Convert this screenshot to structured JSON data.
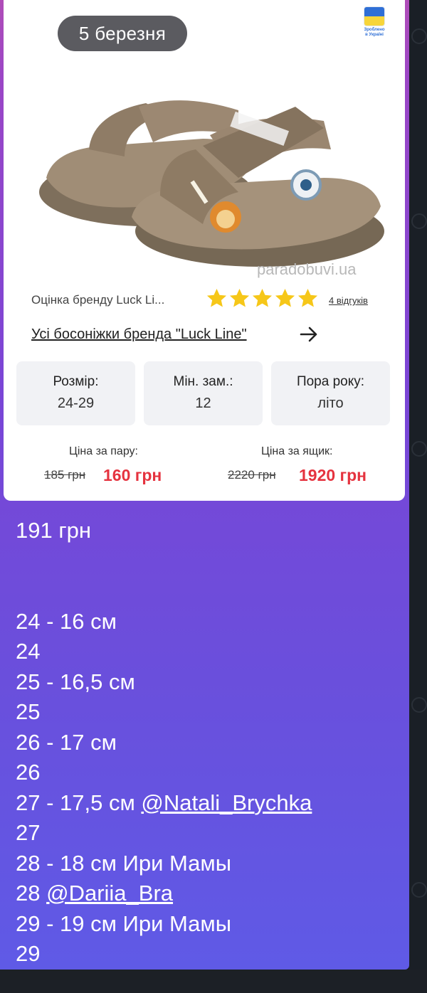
{
  "date_pill": "5 березня",
  "badge_text": [
    "Зроблено",
    "в Україні"
  ],
  "watermark": "paradobuvi.ua",
  "rating": {
    "label": "Оцінка бренду Luck Li...",
    "stars": 5,
    "reviews": "4 відгуків"
  },
  "all_link": "Усі босоніжки бренда \"Luck Line\"",
  "specs": [
    {
      "key": "Розмір:",
      "value": "24-29"
    },
    {
      "key": "Мін. зам.:",
      "value": "12"
    },
    {
      "key": "Пора року:",
      "value": "літо"
    }
  ],
  "prices": {
    "pair_label": "Ціна за пару:",
    "pair_old": "185 грн",
    "pair_new": "160 грн",
    "box_label": "Ціна за ящик:",
    "box_old": "2220 грн",
    "box_new": "1920 грн"
  },
  "message": {
    "price": "191 грн",
    "lines": [
      {
        "text": "24 - 16 см",
        "mention": ""
      },
      {
        "text": "24",
        "mention": ""
      },
      {
        "text": "25 - 16,5 см",
        "mention": ""
      },
      {
        "text": "25",
        "mention": ""
      },
      {
        "text": "26 - 17 см",
        "mention": ""
      },
      {
        "text": "26",
        "mention": ""
      },
      {
        "text": "27 - 17,5 см ",
        "mention": "@Natali_Brychka"
      },
      {
        "text": "27",
        "mention": ""
      },
      {
        "text": "28 - 18 см Ири Мамы",
        "mention": ""
      },
      {
        "text": "28 ",
        "mention": "@Dariia_Bra"
      },
      {
        "text": "29 - 19 см Ири Мамы",
        "mention": ""
      },
      {
        "text": "29",
        "mention": ""
      }
    ]
  },
  "colors": {
    "accent_price": "#e5333f",
    "star": "#f6c719",
    "bubble_top": "#b04db8",
    "bubble_bottom": "#5f5ae6"
  }
}
